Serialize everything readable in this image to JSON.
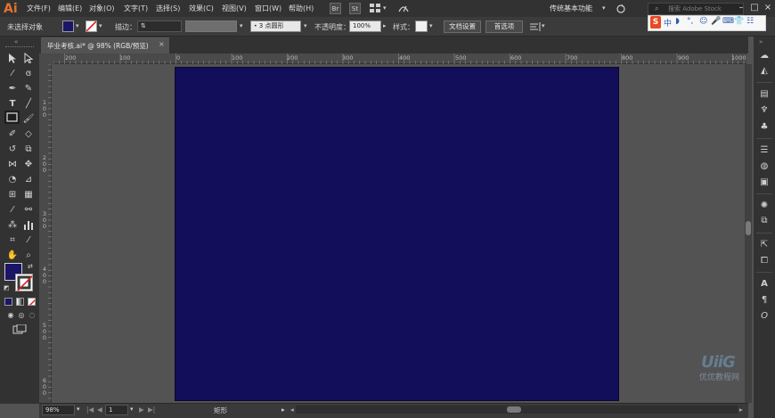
{
  "app": {
    "logo": "Ai",
    "workspace": "传统基本功能",
    "search_placeholder": "搜索 Adobe Stock"
  },
  "menu": {
    "items": [
      "文件(F)",
      "编辑(E)",
      "对象(O)",
      "文字(T)",
      "选择(S)",
      "效果(C)",
      "视图(V)",
      "窗口(W)",
      "帮助(H)"
    ],
    "badges": [
      "Br",
      "St"
    ]
  },
  "control": {
    "selection": "未选择对象",
    "stroke_label": "描边：",
    "brush": "3 点圆形",
    "opacity_label": "不透明度：",
    "opacity_value": "100%",
    "style_label": "样式：",
    "doc_setup": "文档设置",
    "prefs": "首选项",
    "fill_color": "#1a1566"
  },
  "ime": {
    "items": [
      "S",
      "中",
      "◗",
      "°,",
      "☺",
      "🎤",
      "⌨",
      "👕",
      "☷"
    ]
  },
  "tab": {
    "label": "毕业考核.ai* @ 98% (RGB/预览)",
    "close": "×"
  },
  "ruler": {
    "h_labels": [
      "200",
      "100",
      "0",
      "100",
      "200",
      "300",
      "400",
      "500",
      "600",
      "700",
      "800",
      "900",
      "1000"
    ],
    "v_labels": [
      "1 0 0",
      "2 0 0",
      "3 0 0",
      "4 0 0",
      "5 0 0",
      "6 0 0"
    ]
  },
  "artboard": {
    "color": "#130e59"
  },
  "status": {
    "zoom": "98%",
    "page": "1",
    "tool_label": "矩形",
    "nav_first": "|◀",
    "nav_prev": "◀",
    "nav_next": "▶",
    "nav_last": "▶|"
  },
  "watermark": {
    "logo": "UiiG",
    "text": "优优教程网"
  }
}
